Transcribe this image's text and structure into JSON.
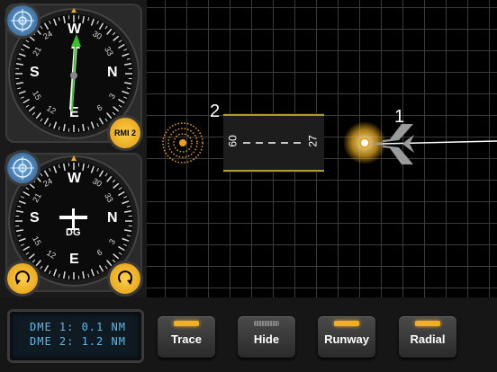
{
  "rmi": {
    "cardinals": {
      "n": "N",
      "s": "S",
      "e": "E",
      "w": "W"
    },
    "numbers": [
      "3",
      "6",
      "12",
      "15",
      "21",
      "24",
      "30",
      "33"
    ],
    "badge_label": "RMI 2"
  },
  "dg": {
    "cardinals": {
      "n": "N",
      "s": "S",
      "e": "E",
      "w": "W"
    },
    "numbers": [
      "3",
      "6",
      "12",
      "15",
      "21",
      "24",
      "30",
      "33"
    ],
    "center_label": "DG"
  },
  "map": {
    "station_labels": [
      "2",
      "1"
    ],
    "runway": {
      "left_number": "60",
      "right_number": "27"
    }
  },
  "dme": {
    "line1": "DME 1: 0.1 NM",
    "line2": "DME 2: 1.2 NM"
  },
  "buttons": [
    {
      "label": "Trace",
      "lamp": "on"
    },
    {
      "label": "Hide",
      "lamp": "off"
    },
    {
      "label": "Runway",
      "lamp": "on"
    },
    {
      "label": "Radial",
      "lamp": "on"
    }
  ],
  "colors": {
    "accent": "#f0b020",
    "needle_green": "#3cbf2e",
    "needle_white": "#f5f5f5",
    "dme_text": "#5fb8e6"
  },
  "icons": [
    "crosshair-icon",
    "rotate-left-icon",
    "rotate-right-icon",
    "airplane-icon"
  ]
}
